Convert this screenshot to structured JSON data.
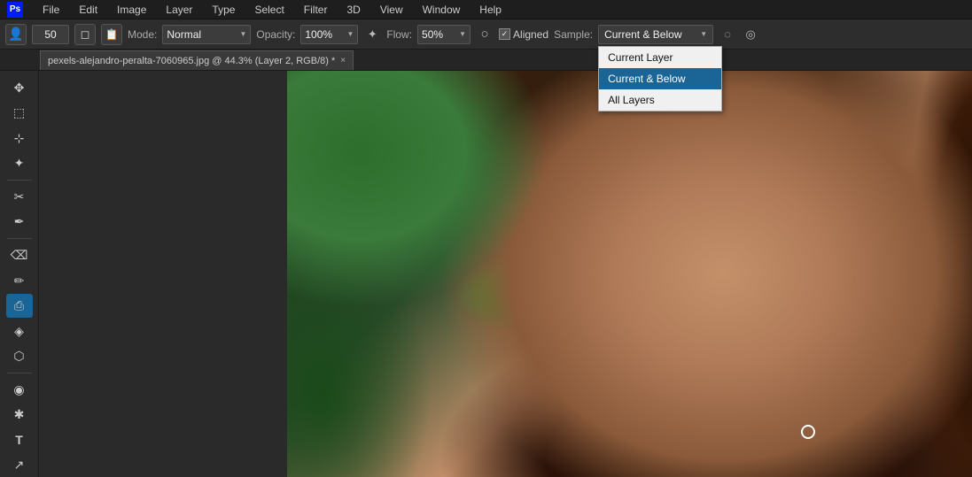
{
  "app": {
    "logo": "Ps",
    "logo_color": "#001aff"
  },
  "menubar": {
    "items": [
      "File",
      "Edit",
      "Image",
      "Layer",
      "Type",
      "Select",
      "Filter",
      "3D",
      "View",
      "Window",
      "Help"
    ]
  },
  "options_bar": {
    "tool_icon": "👤",
    "brush_size_label": "50",
    "brush_icon": "◻",
    "clone_icon": "🗂",
    "mode_label": "Mode:",
    "mode_value": "Normal",
    "opacity_label": "Opacity:",
    "opacity_value": "100%",
    "flow_label": "Flow:",
    "flow_value": "50%",
    "airbrush_icon": "○",
    "aligned_label": "Aligned",
    "sample_label": "Sample:",
    "sample_value": "Current & Below",
    "extra_icon1": "◌",
    "extra_icon2": "◎"
  },
  "sample_dropdown": {
    "options": [
      {
        "label": "Current Layer",
        "selected": false
      },
      {
        "label": "Current & Below",
        "selected": true
      },
      {
        "label": "All Layers",
        "selected": false
      }
    ]
  },
  "tab": {
    "filename": "pexels-alejandro-peralta-7060965.jpg @ 44.3% (Layer 2, RGB/8) *",
    "close_label": "×"
  },
  "tools": [
    {
      "icon": "✥",
      "name": "move-tool",
      "active": false
    },
    {
      "icon": "⬚",
      "name": "selection-tool",
      "active": false
    },
    {
      "icon": "⊹",
      "name": "lasso-tool",
      "active": false
    },
    {
      "icon": "✦",
      "name": "magic-wand-tool",
      "active": false
    },
    {
      "icon": "✂",
      "name": "crop-tool",
      "active": false
    },
    {
      "icon": "✒",
      "name": "eyedropper-tool",
      "active": false
    },
    {
      "icon": "⌫",
      "name": "spot-heal-tool",
      "active": false
    },
    {
      "icon": "✏",
      "name": "brush-tool",
      "active": false
    },
    {
      "icon": "⎙",
      "name": "clone-stamp-tool",
      "active": true
    },
    {
      "icon": "◈",
      "name": "eraser-tool",
      "active": false
    },
    {
      "icon": "⬡",
      "name": "gradient-tool",
      "active": false
    },
    {
      "icon": "◉",
      "name": "dodge-tool",
      "active": false
    },
    {
      "icon": "✱",
      "name": "pen-tool",
      "active": false
    },
    {
      "icon": "T",
      "name": "type-tool",
      "active": false
    },
    {
      "icon": "↗",
      "name": "path-select-tool",
      "active": false
    }
  ]
}
